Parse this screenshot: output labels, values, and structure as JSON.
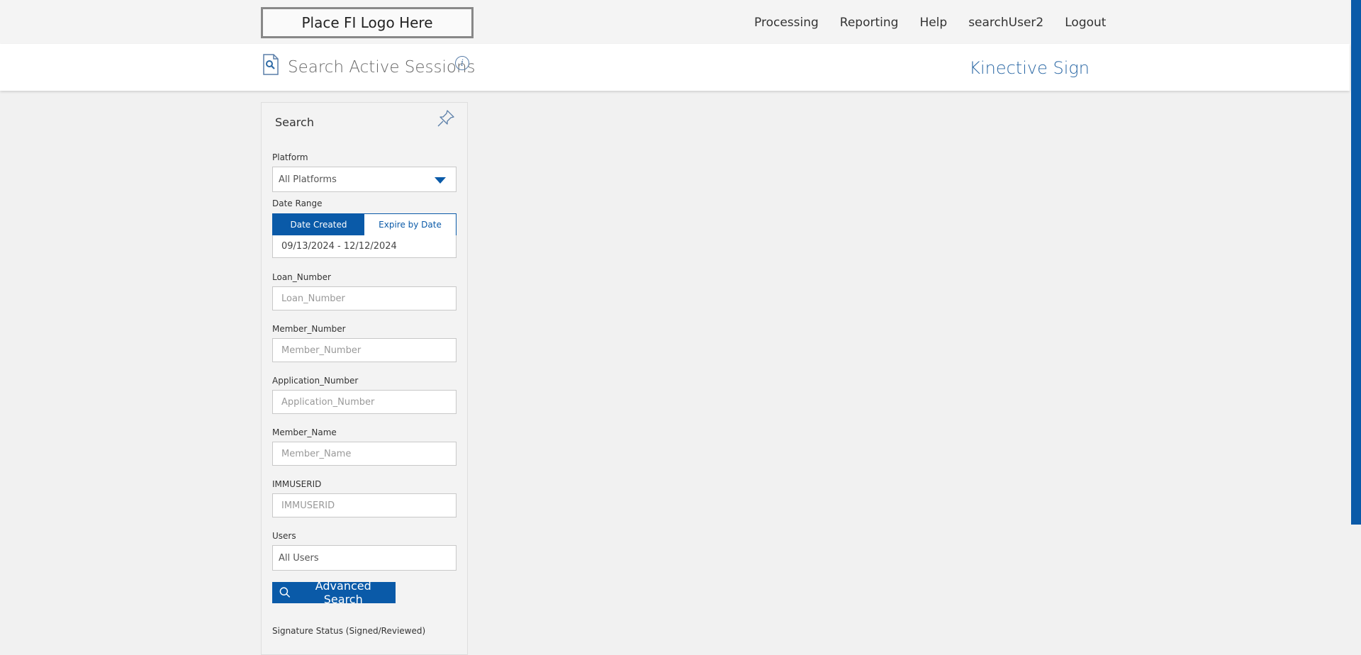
{
  "header": {
    "logo_text": "Place FI Logo Here",
    "nav": [
      "Processing",
      "Reporting",
      "Help",
      "searchUser2",
      "Logout"
    ]
  },
  "page": {
    "title": "Search Active Sessions",
    "info_glyph": "i",
    "brand": "Kinective Sign"
  },
  "search_panel": {
    "title": "Search",
    "platform": {
      "label": "Platform",
      "value": "All Platforms"
    },
    "date_range": {
      "label": "Date Range",
      "options": [
        "Date Created",
        "Expire by Date"
      ],
      "selected": "Date Created",
      "value": "09/13/2024 - 12/12/2024"
    },
    "loan_number": {
      "label": "Loan_Number",
      "placeholder": "Loan_Number"
    },
    "member_number": {
      "label": "Member_Number",
      "placeholder": "Member_Number"
    },
    "application_number": {
      "label": "Application_Number",
      "placeholder": "Application_Number"
    },
    "member_name": {
      "label": "Member_Name",
      "placeholder": "Member_Name"
    },
    "immuserid": {
      "label": "IMMUSERID",
      "placeholder": "IMMUSERID"
    },
    "users": {
      "label": "Users",
      "value": "All Users"
    },
    "advanced_search_label": "Advanced Search",
    "signature_status_label": "Signature Status (Signed/Reviewed)"
  },
  "colors": {
    "accent": "#0a5aa8",
    "brand_text": "#2e6aa6"
  },
  "icons": [
    "document-search-icon",
    "info-icon",
    "pin-icon",
    "chevron-down-icon",
    "search-icon"
  ]
}
